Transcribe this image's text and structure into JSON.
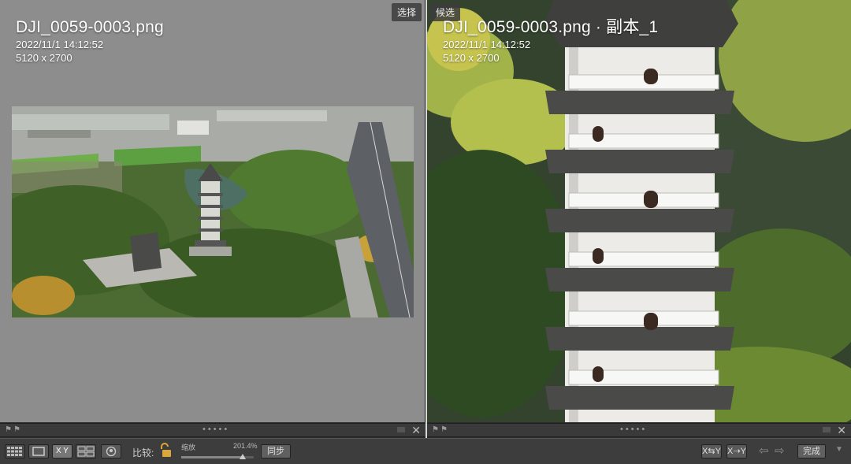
{
  "left_pane": {
    "tag": "选择",
    "filename": "DJI_0059-0003.png",
    "datetime": "2022/11/1 14:12:52",
    "dimensions": "5120 x 2700"
  },
  "right_pane": {
    "tag": "候选",
    "filename": "DJI_0059-0003.png · 副本_1",
    "datetime": "2022/11/1 14:12:52",
    "dimensions": "5120 x 2700"
  },
  "toolbar": {
    "grid_icon": "grid-icon",
    "loupe_icon": "loupe-icon",
    "compare_label": "X Y",
    "survey_icon": "survey-icon",
    "people_icon": "people-icon",
    "compare_text": "比较:",
    "zoom_label": "缩放",
    "zoom_value": "201.4%",
    "zoom_fraction": 0.85,
    "sync_label": "同步",
    "swap_label": "X⇆Y",
    "make_select_label": "X⇢Y",
    "done_label": "完成"
  },
  "colors": {
    "left_background": "#8d8d8d",
    "toolbar": "#3d3d3d",
    "water": "#3b4a34",
    "foliage": "#6f8f3c"
  }
}
